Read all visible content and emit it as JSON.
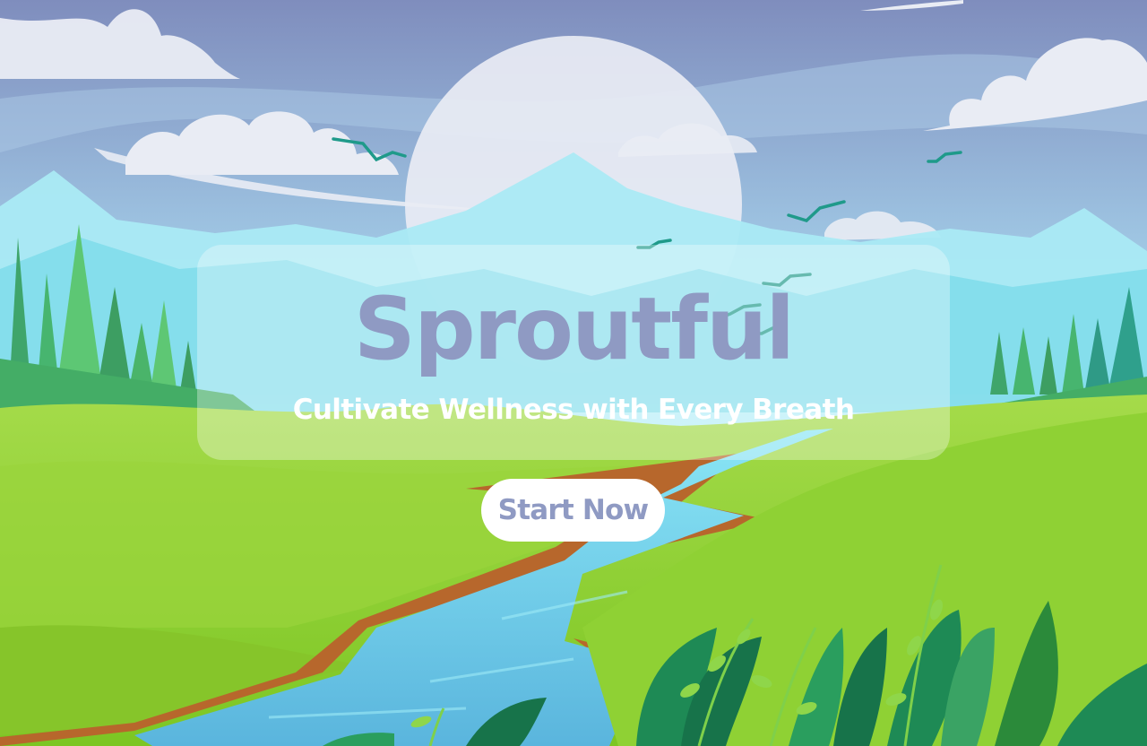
{
  "hero": {
    "title": "Sproutful",
    "tagline": "Cultivate Wellness with Every Breath",
    "cta_label": "Start Now"
  },
  "colors": {
    "title": "#8f9ac3",
    "tagline": "#ffffff",
    "cta_background": "#ffffff",
    "cta_text": "#8f9ac3",
    "sky_top": "#7f8dbd",
    "grass": "#8fd134",
    "river": "#6cc7e6"
  },
  "background": {
    "illustration": "landscape-illustration",
    "icons": [
      "sun-icon",
      "cloud-icon",
      "bird-icon",
      "pine-tree-icon",
      "leaf-icon"
    ]
  }
}
